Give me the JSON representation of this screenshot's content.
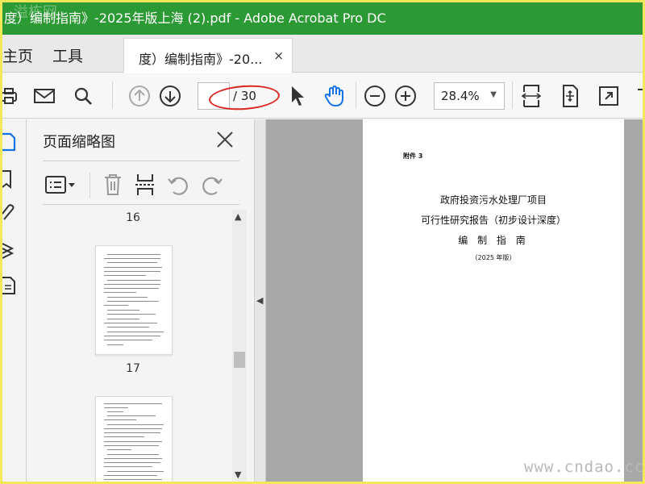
{
  "window": {
    "title": "度）编制指南》-2025年版上海 (2).pdf - Adobe Acrobat Pro DC",
    "watermark_logo": "溢栋网",
    "titlebar_color": "#2c9a34"
  },
  "nav": {
    "home": "主页",
    "tools": "工具"
  },
  "tab": {
    "label": "度）编制指南》-20...",
    "close": "×"
  },
  "toolbar": {
    "page_current": "",
    "page_total": "/ 30",
    "zoom": "28.4%",
    "icons": [
      "print-icon",
      "mail-icon",
      "search-icon",
      "prev-page-icon",
      "next-page-icon",
      "select-cursor-icon",
      "hand-tool-icon",
      "zoom-out-icon",
      "zoom-in-icon",
      "fit-page-icon",
      "scroll-mode-icon",
      "fullscreen-icon"
    ],
    "annotation_color": "#d9271f"
  },
  "panel": {
    "title": "页面缩略图",
    "tools": [
      "options-icon",
      "delete-icon",
      "insert-page-icon",
      "rotate-left-icon",
      "rotate-right-icon"
    ],
    "thumbnails": [
      {
        "page": "16"
      },
      {
        "page": "17"
      }
    ]
  },
  "document": {
    "attachment": "附件 3",
    "title_line1": "政府投资污水处理厂项目",
    "title_line2": "可行性研究报告（初步设计深度）",
    "title_line3": "编 制 指 南",
    "year": "（2025 年版）"
  },
  "site_watermark": "www.cndao.cc"
}
